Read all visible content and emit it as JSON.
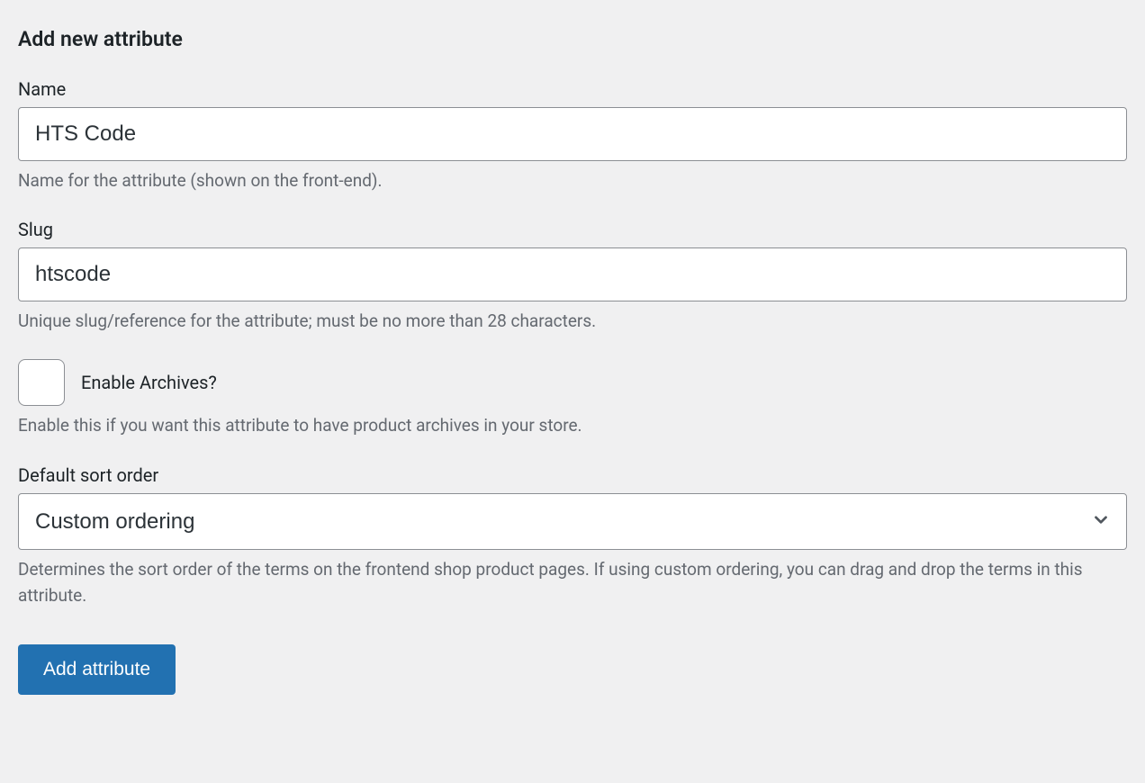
{
  "form": {
    "title": "Add new attribute",
    "name": {
      "label": "Name",
      "value": "HTS Code",
      "description": "Name for the attribute (shown on the front-end)."
    },
    "slug": {
      "label": "Slug",
      "value": "htscode",
      "description": "Unique slug/reference for the attribute; must be no more than 28 characters."
    },
    "archives": {
      "label": "Enable Archives?",
      "checked": false,
      "description": "Enable this if you want this attribute to have product archives in your store."
    },
    "sort_order": {
      "label": "Default sort order",
      "selected": "Custom ordering",
      "description": "Determines the sort order of the terms on the frontend shop product pages. If using custom ordering, you can drag and drop the terms in this attribute."
    },
    "submit_label": "Add attribute"
  }
}
